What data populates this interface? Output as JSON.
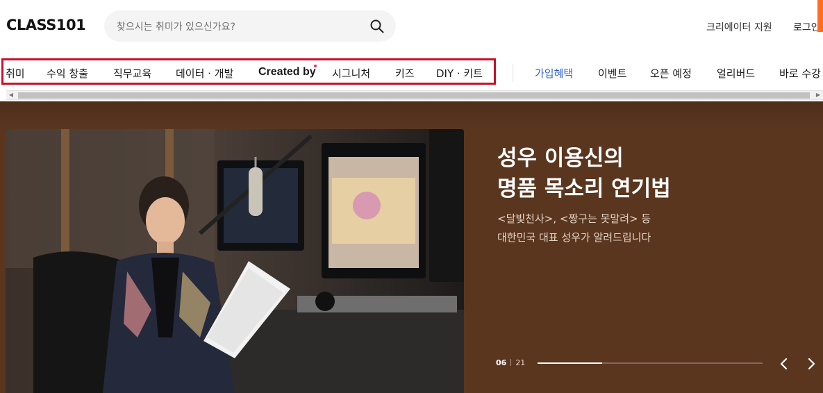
{
  "header": {
    "logo": "CLASS101",
    "search_placeholder": "찾으시는 취미가 있으신가요?",
    "creator_support": "크리에이터 지원",
    "login": "로그인"
  },
  "nav": {
    "categories": [
      "취미",
      "수익 창출",
      "직무교육",
      "데이터 · 개발",
      "Created by",
      "시그니처",
      "키즈",
      "DIY · 키트"
    ],
    "extras": [
      "가입혜택",
      "이벤트",
      "오픈 예정",
      "얼리버드",
      "바로 수강"
    ],
    "accent_color": "#2c5fd6",
    "highlight_color": "#c8102e"
  },
  "banner": {
    "title_line1": "성우 이용신의",
    "title_line2": "명품 목소리 연기법",
    "subtitle_line1": "<달빛천사>, <짱구는 못말려> 등",
    "subtitle_line2": "대한민국 대표 성우가 알려드립니다",
    "current": "06",
    "total": "21",
    "progress": 0.2857,
    "background_color": "#5a361f"
  }
}
